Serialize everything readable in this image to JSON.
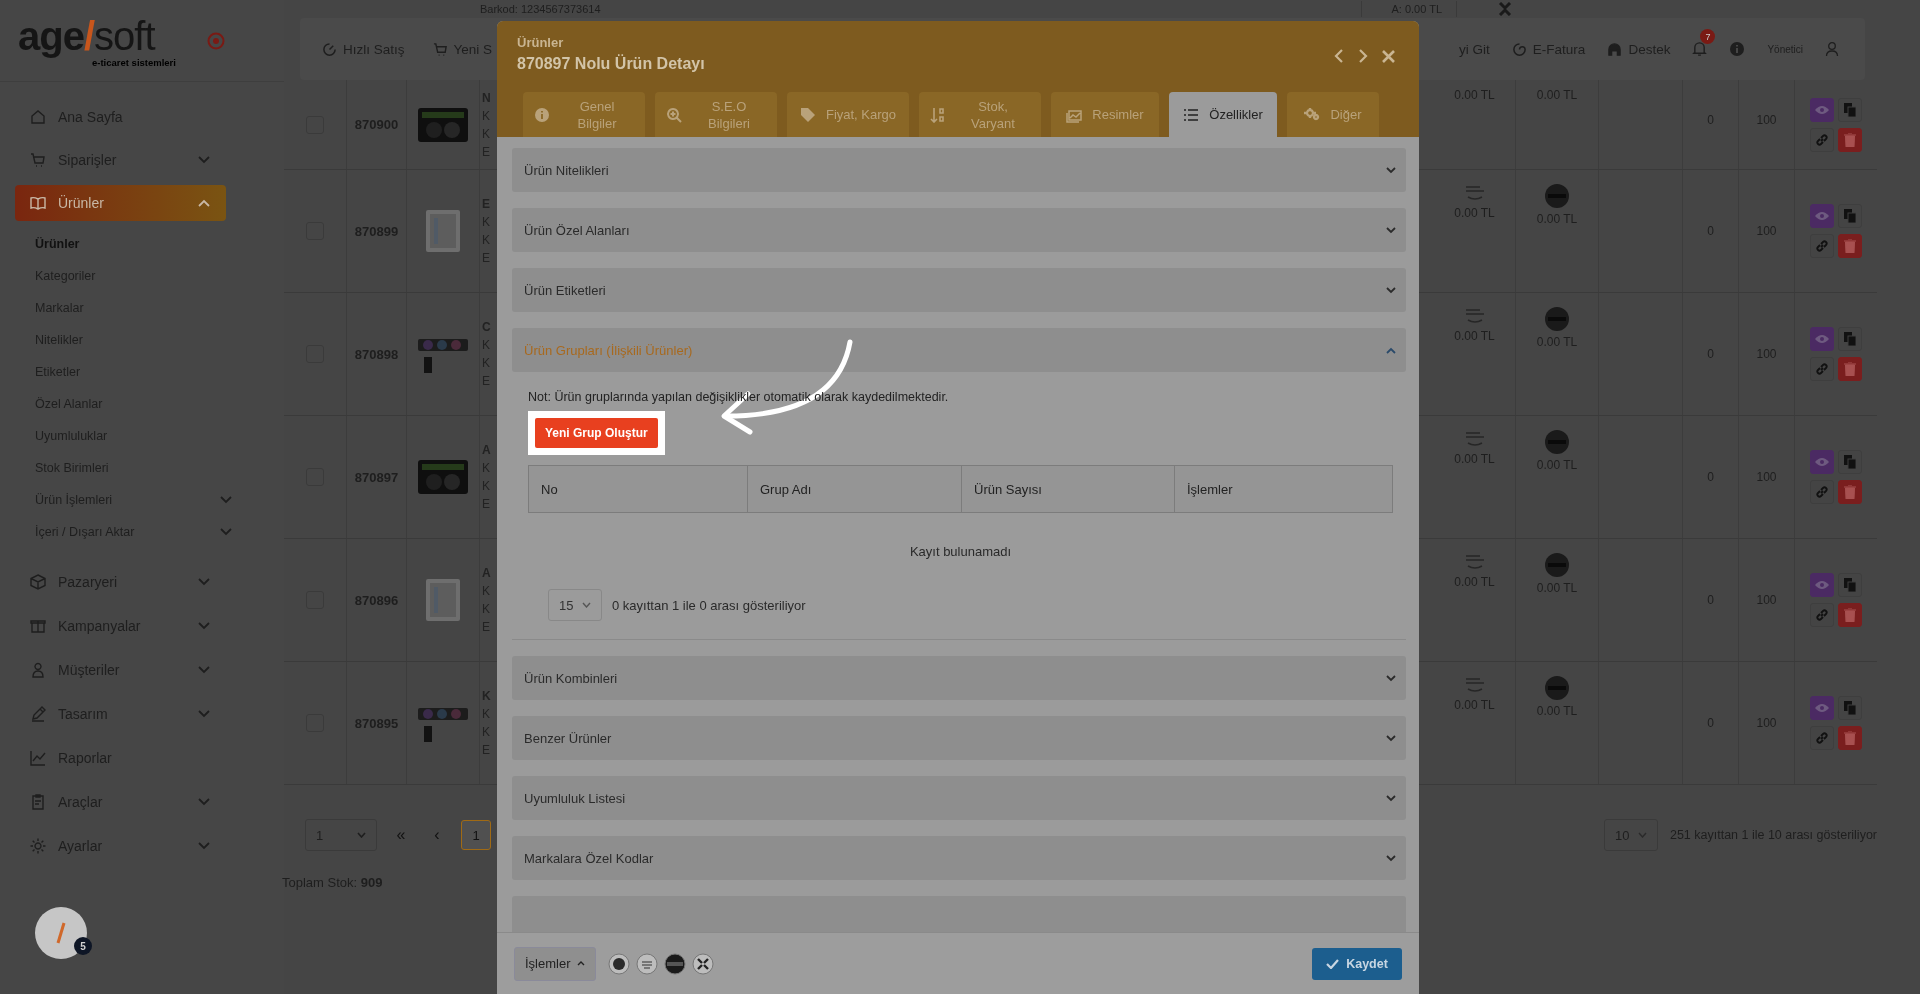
{
  "sidebar": {
    "logo": {
      "left": "age",
      "slash": "/",
      "right": "soft",
      "tagline": "e-ticaret sistemleri"
    },
    "items": [
      {
        "label": "Ana Sayfa",
        "selected": false
      },
      {
        "label": "Siparişler",
        "expanded": false,
        "selected": false
      },
      {
        "label": "Ürünler",
        "expanded": true,
        "selected": true,
        "children": [
          {
            "label": "Ürünler",
            "selected": true
          },
          {
            "label": "Kategoriler",
            "selected": false
          },
          {
            "label": "Markalar",
            "selected": false
          },
          {
            "label": "Nitelikler",
            "selected": false
          },
          {
            "label": "Etiketler",
            "selected": false
          },
          {
            "label": "Özel Alanlar",
            "selected": false
          },
          {
            "label": "Uyumluluklar",
            "selected": false
          },
          {
            "label": "Stok Birimleri",
            "selected": false
          },
          {
            "label": "Ürün İşlemleri",
            "expanded": false,
            "selected": false
          },
          {
            "label": "İçeri / Dışarı Aktar",
            "expanded": false,
            "selected": false
          }
        ]
      },
      {
        "label": "Pazaryeri",
        "expanded": false,
        "selected": false
      },
      {
        "label": "Kampanyalar",
        "expanded": false,
        "selected": false
      },
      {
        "label": "Müşteriler",
        "expanded": false,
        "selected": false
      },
      {
        "label": "Tasarım",
        "expanded": false,
        "selected": false
      },
      {
        "label": "Raporlar",
        "selected": false
      },
      {
        "label": "Araçlar",
        "expanded": false,
        "selected": false
      },
      {
        "label": "Ayarlar",
        "expanded": false,
        "selected": false
      }
    ]
  },
  "topbar": {
    "left": [
      {
        "label": "Hızlı Satış"
      },
      {
        "label": "Yeni S"
      }
    ],
    "right": [
      {
        "label": "yi Git"
      },
      {
        "label": "E-Fatura"
      },
      {
        "label": "Destek"
      }
    ],
    "notification_count": "7",
    "user": "Yönetici"
  },
  "partial_row": {
    "barcode": "Barkod: 1234567373614",
    "price": "A: 0.00 TL"
  },
  "products": [
    {
      "id": "870900",
      "name_visible": "N",
      "lines_visible": [
        "K",
        "K",
        "E"
      ],
      "logos_visible": false,
      "prices": [
        "0.00 TL",
        "0.00 TL"
      ],
      "stock": "0",
      "quantity": "100",
      "checked": false
    },
    {
      "id": "870899",
      "name_visible": "E",
      "lines_visible": [
        "K",
        "K",
        "E"
      ],
      "logos_visible": true,
      "prices": [
        "0.00 TL",
        "0.00 TL"
      ],
      "stock": "0",
      "quantity": "100",
      "checked": false
    },
    {
      "id": "870898",
      "name_visible": "C",
      "lines_visible": [
        "K",
        "K",
        "E"
      ],
      "logos_visible": true,
      "prices": [
        "0.00 TL",
        "0.00 TL"
      ],
      "stock": "0",
      "quantity": "100",
      "checked": false
    },
    {
      "id": "870897",
      "name_visible": "A",
      "lines_visible": [
        "K",
        "K",
        "E"
      ],
      "logos_visible": true,
      "prices": [
        "0.00 TL",
        "0.00 TL"
      ],
      "stock": "0",
      "quantity": "100",
      "checked": false
    },
    {
      "id": "870896",
      "name_visible": "A",
      "lines_visible": [
        "K",
        "K",
        "E"
      ],
      "logos_visible": true,
      "prices": [
        "0.00 TL",
        "0.00 TL"
      ],
      "stock": "0",
      "quantity": "100",
      "checked": false
    },
    {
      "id": "870895",
      "name_visible": "K",
      "lines_visible": [
        "K",
        "K",
        "E"
      ],
      "logos_visible": true,
      "prices": [
        "0.00 TL",
        "0.00 TL"
      ],
      "stock": "0",
      "quantity": "100",
      "checked": false
    }
  ],
  "pagination": {
    "page_select": "1",
    "first": "«",
    "prev": "‹",
    "pages": [
      {
        "label": "1",
        "selected": true
      }
    ],
    "page_size": "10",
    "info": "251 kayıttan 1 ile 10 arası gösteriliyor"
  },
  "total_stock": {
    "label": "Toplam Stok:",
    "value": "909"
  },
  "help_badge": "5",
  "modal": {
    "breadcrumb": "Ürünler",
    "title": "870897 Nolu Ürün Detayı",
    "tabs": [
      {
        "label": "Genel Bilgiler",
        "selected": false
      },
      {
        "label": "S.E.O Bilgileri",
        "selected": false
      },
      {
        "label": "Fiyat, Kargo",
        "selected": false
      },
      {
        "label": "Stok, Varyant",
        "selected": false
      },
      {
        "label": "Resimler",
        "selected": false
      },
      {
        "label": "Özellikler",
        "selected": true
      },
      {
        "label": "Diğer",
        "selected": false
      }
    ],
    "sections": [
      {
        "title": "Ürün Nitelikleri",
        "expanded": false
      },
      {
        "title": "Ürün Özel Alanları",
        "expanded": false
      },
      {
        "title": "Ürün Etiketleri",
        "expanded": false
      },
      {
        "title": "Ürün Grupları (İlişkili Ürünler)",
        "expanded": true,
        "note": "Not: Ürün gruplarında yapılan değişiklikler otomatik olarak kaydedilmektedir.",
        "button": {
          "label": "Yeni Grup Oluştur",
          "highlighted": true
        },
        "columns": [
          "No",
          "Grup Adı",
          "Ürün Sayısı",
          "İşlemler"
        ],
        "empty_text": "Kayıt bulunamadı",
        "page_size": "15",
        "info": "0 kayıttan 1 ile 0 arası gösteriliyor"
      },
      {
        "title": "Ürün Kombinleri",
        "expanded": false
      },
      {
        "title": "Benzer Ürünler",
        "expanded": false
      },
      {
        "title": "Uyumluluk Listesi",
        "expanded": false
      },
      {
        "title": "Markalara Özel Kodlar",
        "expanded": false
      }
    ],
    "actions_label": "İşlemler",
    "save_label": "Kaydet"
  }
}
